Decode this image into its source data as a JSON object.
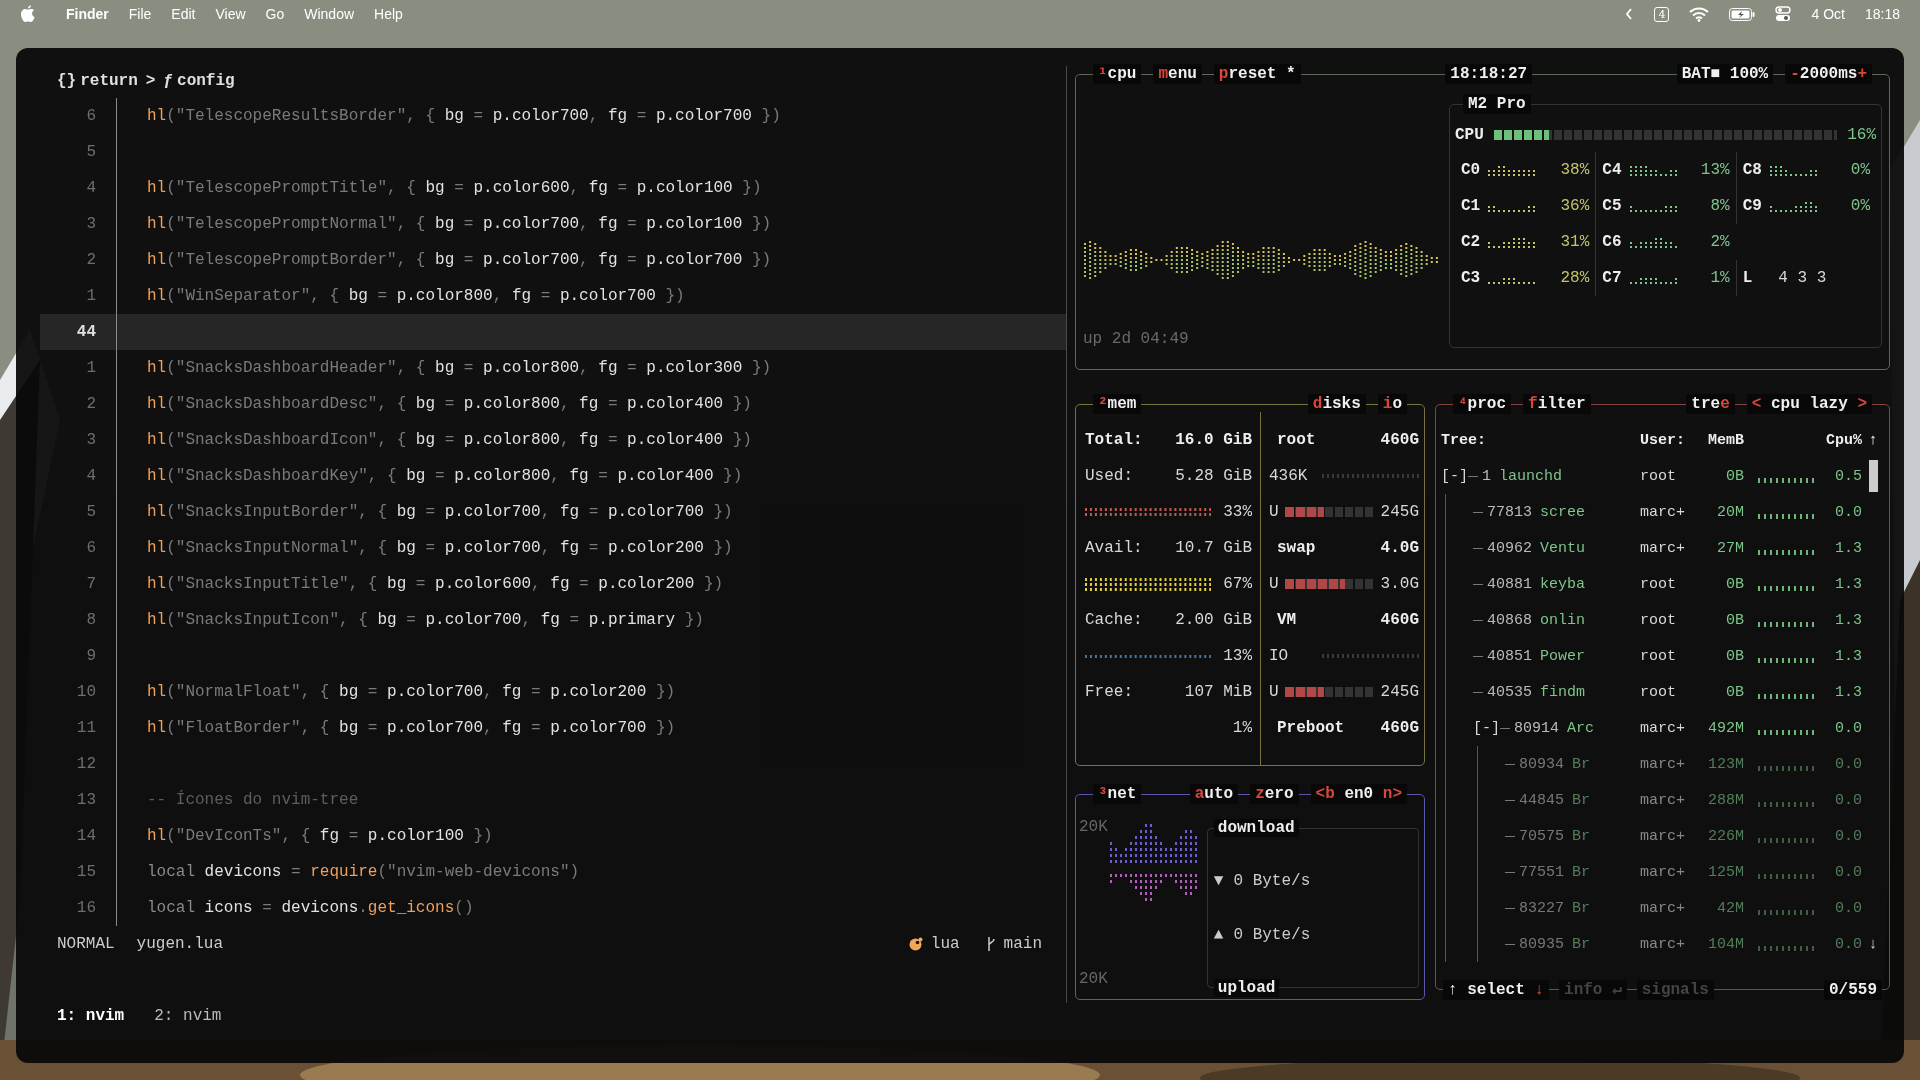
{
  "menubar": {
    "app": "Finder",
    "menus": [
      "File",
      "Edit",
      "View",
      "Go",
      "Window",
      "Help"
    ],
    "calendar_day": "4",
    "date": "4 Oct",
    "time": "18:18"
  },
  "editor": {
    "breadcrumb": [
      {
        "icon": "{}",
        "text": "return"
      },
      {
        "icon": "ƒ",
        "text": "config"
      }
    ],
    "separator": ">",
    "lines": [
      {
        "num": "6",
        "current": false,
        "tokens": [
          {
            "kind": "fn",
            "text": "hl"
          },
          {
            "kind": "dim",
            "text": "(\"TelescopeResultsBorder\", { "
          },
          {
            "kind": "text",
            "text": "bg"
          },
          {
            "kind": "dim",
            "text": " = "
          },
          {
            "kind": "text",
            "text": "p.color700"
          },
          {
            "kind": "dim",
            "text": ", "
          },
          {
            "kind": "text",
            "text": "fg"
          },
          {
            "kind": "dim",
            "text": " = "
          },
          {
            "kind": "text",
            "text": "p.color700"
          },
          {
            "kind": "dim",
            "text": " })"
          }
        ]
      },
      {
        "num": "5",
        "current": false
      },
      {
        "num": "4",
        "current": false,
        "tokens": [
          {
            "kind": "fn",
            "text": "hl"
          },
          {
            "kind": "dim",
            "text": "(\"TelescopePromptTitle\", { "
          },
          {
            "kind": "text",
            "text": "bg"
          },
          {
            "kind": "dim",
            "text": " = "
          },
          {
            "kind": "text",
            "text": "p.color600"
          },
          {
            "kind": "dim",
            "text": ", "
          },
          {
            "kind": "text",
            "text": "fg"
          },
          {
            "kind": "dim",
            "text": " = "
          },
          {
            "kind": "text",
            "text": "p.color100"
          },
          {
            "kind": "dim",
            "text": " })"
          }
        ]
      },
      {
        "num": "3",
        "current": false,
        "tokens": [
          {
            "kind": "fn",
            "text": "hl"
          },
          {
            "kind": "dim",
            "text": "(\"TelescopePromptNormal\", { "
          },
          {
            "kind": "text",
            "text": "bg"
          },
          {
            "kind": "dim",
            "text": " = "
          },
          {
            "kind": "text",
            "text": "p.color700"
          },
          {
            "kind": "dim",
            "text": ", "
          },
          {
            "kind": "text",
            "text": "fg"
          },
          {
            "kind": "dim",
            "text": " = "
          },
          {
            "kind": "text",
            "text": "p.color100"
          },
          {
            "kind": "dim",
            "text": " })"
          }
        ]
      },
      {
        "num": "2",
        "current": false,
        "tokens": [
          {
            "kind": "fn",
            "text": "hl"
          },
          {
            "kind": "dim",
            "text": "(\"TelescopePromptBorder\", { "
          },
          {
            "kind": "text",
            "text": "bg"
          },
          {
            "kind": "dim",
            "text": " = "
          },
          {
            "kind": "text",
            "text": "p.color700"
          },
          {
            "kind": "dim",
            "text": ", "
          },
          {
            "kind": "text",
            "text": "fg"
          },
          {
            "kind": "dim",
            "text": " = "
          },
          {
            "kind": "text",
            "text": "p.color700"
          },
          {
            "kind": "dim",
            "text": " })"
          }
        ]
      },
      {
        "num": "1",
        "current": false,
        "tokens": [
          {
            "kind": "fn",
            "text": "hl"
          },
          {
            "kind": "dim",
            "text": "(\"WinSeparator\", { "
          },
          {
            "kind": "text",
            "text": "bg"
          },
          {
            "kind": "dim",
            "text": " = "
          },
          {
            "kind": "text",
            "text": "p.color800"
          },
          {
            "kind": "dim",
            "text": ", "
          },
          {
            "kind": "text",
            "text": "fg"
          },
          {
            "kind": "dim",
            "text": " = "
          },
          {
            "kind": "text",
            "text": "p.color700"
          },
          {
            "kind": "dim",
            "text": " })"
          }
        ]
      },
      {
        "num": "44",
        "current": true
      },
      {
        "num": "1",
        "current": false,
        "tokens": [
          {
            "kind": "fn",
            "text": "hl"
          },
          {
            "kind": "dim",
            "text": "(\"SnacksDashboardHeader\", { "
          },
          {
            "kind": "text",
            "text": "bg"
          },
          {
            "kind": "dim",
            "text": " = "
          },
          {
            "kind": "text",
            "text": "p.color800"
          },
          {
            "kind": "dim",
            "text": ", "
          },
          {
            "kind": "text",
            "text": "fg"
          },
          {
            "kind": "dim",
            "text": " = "
          },
          {
            "kind": "text",
            "text": "p.color300"
          },
          {
            "kind": "dim",
            "text": " })"
          }
        ]
      },
      {
        "num": "2",
        "current": false,
        "tokens": [
          {
            "kind": "fn",
            "text": "hl"
          },
          {
            "kind": "dim",
            "text": "(\"SnacksDashboardDesc\", { "
          },
          {
            "kind": "text",
            "text": "bg"
          },
          {
            "kind": "dim",
            "text": " = "
          },
          {
            "kind": "text",
            "text": "p.color800"
          },
          {
            "kind": "dim",
            "text": ", "
          },
          {
            "kind": "text",
            "text": "fg"
          },
          {
            "kind": "dim",
            "text": " = "
          },
          {
            "kind": "text",
            "text": "p.color400"
          },
          {
            "kind": "dim",
            "text": " })"
          }
        ]
      },
      {
        "num": "3",
        "current": false,
        "tokens": [
          {
            "kind": "fn",
            "text": "hl"
          },
          {
            "kind": "dim",
            "text": "(\"SnacksDashboardIcon\", { "
          },
          {
            "kind": "text",
            "text": "bg"
          },
          {
            "kind": "dim",
            "text": " = "
          },
          {
            "kind": "text",
            "text": "p.color800"
          },
          {
            "kind": "dim",
            "text": ", "
          },
          {
            "kind": "text",
            "text": "fg"
          },
          {
            "kind": "dim",
            "text": " = "
          },
          {
            "kind": "text",
            "text": "p.color400"
          },
          {
            "kind": "dim",
            "text": " })"
          }
        ]
      },
      {
        "num": "4",
        "current": false,
        "tokens": [
          {
            "kind": "fn",
            "text": "hl"
          },
          {
            "kind": "dim",
            "text": "(\"SnacksDashboardKey\", { "
          },
          {
            "kind": "text",
            "text": "bg"
          },
          {
            "kind": "dim",
            "text": " = "
          },
          {
            "kind": "text",
            "text": "p.color800"
          },
          {
            "kind": "dim",
            "text": ", "
          },
          {
            "kind": "text",
            "text": "fg"
          },
          {
            "kind": "dim",
            "text": " = "
          },
          {
            "kind": "text",
            "text": "p.color400"
          },
          {
            "kind": "dim",
            "text": " })"
          }
        ]
      },
      {
        "num": "5",
        "current": false,
        "tokens": [
          {
            "kind": "fn",
            "text": "hl"
          },
          {
            "kind": "dim",
            "text": "(\"SnacksInputBorder\", { "
          },
          {
            "kind": "text",
            "text": "bg"
          },
          {
            "kind": "dim",
            "text": " = "
          },
          {
            "kind": "text",
            "text": "p.color700"
          },
          {
            "kind": "dim",
            "text": ", "
          },
          {
            "kind": "text",
            "text": "fg"
          },
          {
            "kind": "dim",
            "text": " = "
          },
          {
            "kind": "text",
            "text": "p.color700"
          },
          {
            "kind": "dim",
            "text": " })"
          }
        ]
      },
      {
        "num": "6",
        "current": false,
        "tokens": [
          {
            "kind": "fn",
            "text": "hl"
          },
          {
            "kind": "dim",
            "text": "(\"SnacksInputNormal\", { "
          },
          {
            "kind": "text",
            "text": "bg"
          },
          {
            "kind": "dim",
            "text": " = "
          },
          {
            "kind": "text",
            "text": "p.color700"
          },
          {
            "kind": "dim",
            "text": ", "
          },
          {
            "kind": "text",
            "text": "fg"
          },
          {
            "kind": "dim",
            "text": " = "
          },
          {
            "kind": "text",
            "text": "p.color200"
          },
          {
            "kind": "dim",
            "text": " })"
          }
        ]
      },
      {
        "num": "7",
        "current": false,
        "tokens": [
          {
            "kind": "fn",
            "text": "hl"
          },
          {
            "kind": "dim",
            "text": "(\"SnacksInputTitle\", { "
          },
          {
            "kind": "text",
            "text": "bg"
          },
          {
            "kind": "dim",
            "text": " = "
          },
          {
            "kind": "text",
            "text": "p.color600"
          },
          {
            "kind": "dim",
            "text": ", "
          },
          {
            "kind": "text",
            "text": "fg"
          },
          {
            "kind": "dim",
            "text": " = "
          },
          {
            "kind": "text",
            "text": "p.color200"
          },
          {
            "kind": "dim",
            "text": " })"
          }
        ]
      },
      {
        "num": "8",
        "current": false,
        "tokens": [
          {
            "kind": "fn",
            "text": "hl"
          },
          {
            "kind": "dim",
            "text": "(\"SnacksInputIcon\", { "
          },
          {
            "kind": "text",
            "text": "bg"
          },
          {
            "kind": "dim",
            "text": " = "
          },
          {
            "kind": "text",
            "text": "p.color700"
          },
          {
            "kind": "dim",
            "text": ", "
          },
          {
            "kind": "text",
            "text": "fg"
          },
          {
            "kind": "dim",
            "text": " = "
          },
          {
            "kind": "text",
            "text": "p.primary"
          },
          {
            "kind": "dim",
            "text": " })"
          }
        ]
      },
      {
        "num": "9",
        "current": false
      },
      {
        "num": "10",
        "current": false,
        "tokens": [
          {
            "kind": "fn",
            "text": "hl"
          },
          {
            "kind": "dim",
            "text": "(\"NormalFloat\", { "
          },
          {
            "kind": "text",
            "text": "bg"
          },
          {
            "kind": "dim",
            "text": " = "
          },
          {
            "kind": "text",
            "text": "p.color700"
          },
          {
            "kind": "dim",
            "text": ", "
          },
          {
            "kind": "text",
            "text": "fg"
          },
          {
            "kind": "dim",
            "text": " = "
          },
          {
            "kind": "text",
            "text": "p.color200"
          },
          {
            "kind": "dim",
            "text": " })"
          }
        ]
      },
      {
        "num": "11",
        "current": false,
        "tokens": [
          {
            "kind": "fn",
            "text": "hl"
          },
          {
            "kind": "dim",
            "text": "(\"FloatBorder\", { "
          },
          {
            "kind": "text",
            "text": "bg"
          },
          {
            "kind": "dim",
            "text": " = "
          },
          {
            "kind": "text",
            "text": "p.color700"
          },
          {
            "kind": "dim",
            "text": ", "
          },
          {
            "kind": "text",
            "text": "fg"
          },
          {
            "kind": "dim",
            "text": " = "
          },
          {
            "kind": "text",
            "text": "p.color700"
          },
          {
            "kind": "dim",
            "text": " })"
          }
        ]
      },
      {
        "num": "12",
        "current": false
      },
      {
        "num": "13",
        "current": false,
        "tokens": [
          {
            "kind": "comment",
            "text": "-- Ícones do nvim-tree"
          }
        ]
      },
      {
        "num": "14",
        "current": false,
        "tokens": [
          {
            "kind": "fn",
            "text": "hl"
          },
          {
            "kind": "dim",
            "text": "(\"DevIconTs\", { "
          },
          {
            "kind": "text",
            "text": "fg"
          },
          {
            "kind": "dim",
            "text": " = "
          },
          {
            "kind": "text",
            "text": "p.color100"
          },
          {
            "kind": "dim",
            "text": " })"
          }
        ]
      },
      {
        "num": "15",
        "current": false,
        "tokens": [
          {
            "kind": "kw",
            "text": "local "
          },
          {
            "kind": "text",
            "text": "devicons"
          },
          {
            "kind": "dim",
            "text": " = "
          },
          {
            "kind": "fn",
            "text": "require"
          },
          {
            "kind": "dim",
            "text": "(\"nvim-web-devicons\")"
          }
        ]
      },
      {
        "num": "16",
        "current": false,
        "tokens": [
          {
            "kind": "kw",
            "text": "local "
          },
          {
            "kind": "text",
            "text": "icons"
          },
          {
            "kind": "dim",
            "text": " = "
          },
          {
            "kind": "text",
            "text": "devicons"
          },
          {
            "kind": "dim",
            "text": "."
          },
          {
            "kind": "fn",
            "text": "get_icons"
          },
          {
            "kind": "dim",
            "text": "()"
          }
        ]
      }
    ],
    "status": {
      "mode": "NORMAL",
      "file": "yugen.lua",
      "filetype": "lua",
      "branch": "main"
    },
    "tabs": [
      {
        "label": "1: nvim",
        "selected": true
      },
      {
        "label": "2: nvim",
        "selected": false
      }
    ]
  },
  "cpu": {
    "header": [
      {
        "parts": [
          {
            "text": "¹",
            "hot": true
          },
          {
            "text": "cpu",
            "hot": false
          }
        ]
      },
      {
        "parts": [
          {
            "text": "m",
            "hot": true
          },
          {
            "text": "enu",
            "hot": false
          }
        ]
      },
      {
        "parts": [
          {
            "text": "p",
            "hot": true
          },
          {
            "text": "reset *",
            "hot": false
          }
        ]
      }
    ],
    "clock": "18:18:27",
    "battery": "BAT■ 100%",
    "interval": {
      "minus": "-",
      "value": "2000ms",
      "plus": "+"
    },
    "uptime": "up 2d 04:49",
    "model": "M2 Pro",
    "total": {
      "label": "CPU",
      "level": 0.16,
      "reading": "16%"
    },
    "cores": [
      {
        "name": "C0",
        "reading": "38%",
        "color": "#c5c36e"
      },
      {
        "name": "C1",
        "reading": "36%",
        "color": "#c5c36e"
      },
      {
        "name": "C2",
        "reading": "31%",
        "color": "#c5c36e"
      },
      {
        "name": "C3",
        "reading": "28%",
        "color": "#c5c36e"
      },
      {
        "name": "C4",
        "reading": "13%",
        "color": "#7ec58c"
      },
      {
        "name": "C5",
        "reading": "8%",
        "color": "#7ec58c"
      },
      {
        "name": "C6",
        "reading": "2%",
        "color": "#7ec58c"
      },
      {
        "name": "C7",
        "reading": "1%",
        "color": "#7ec58c"
      },
      {
        "name": "C8",
        "reading": "0%",
        "color": "#7ec58c"
      },
      {
        "name": "C9",
        "reading": "0%",
        "color": "#7ec58c"
      }
    ],
    "load": {
      "label": "L",
      "values": "4 3 3"
    }
  },
  "mem": {
    "header": [
      {
        "parts": [
          {
            "text": "²",
            "hot": true
          },
          {
            "text": "mem",
            "hot": false
          }
        ]
      },
      {
        "parts": [
          {
            "text": "d",
            "hot": true
          },
          {
            "text": "isks",
            "hot": false
          }
        ]
      },
      {
        "parts": [
          {
            "text": "i",
            "hot": true
          },
          {
            "text": "o",
            "hot": false
          }
        ]
      }
    ],
    "items": [
      {
        "label": "Total:",
        "value": "16.0 GiB",
        "bold": true
      },
      {
        "label": "Used:",
        "value": "5.28 GiB",
        "bold": false,
        "reading": "33%",
        "color": "#c65a52"
      },
      {
        "label": "Avail:",
        "value": "10.7 GiB",
        "bold": false,
        "reading": "67%",
        "color": "#e6d43c"
      },
      {
        "label": "Cache:",
        "value": "2.00 GiB",
        "bold": false,
        "reading": "13%",
        "color": "#3f78a8"
      },
      {
        "label": "Free:",
        "value": "107 MiB",
        "bold": false,
        "reading": "1%"
      }
    ],
    "disks": [
      {
        "name": "root",
        "size": "460G",
        "io": "436K",
        "usage": {
          "label": "U",
          "level": 0.44,
          "reading": "245G"
        }
      },
      {
        "name": "swap",
        "size": "4.0G",
        "usage": {
          "label": "U",
          "level": 0.67,
          "reading": "3.0G"
        }
      },
      {
        "name": "VM",
        "size": "460G",
        "io": "IO",
        "usage": {
          "label": "U",
          "level": 0.44,
          "reading": "245G"
        }
      },
      {
        "name": "Preboot",
        "size": "460G"
      }
    ]
  },
  "net": {
    "header": [
      {
        "parts": [
          {
            "text": "³",
            "hot": true
          },
          {
            "text": "net",
            "hot": false
          }
        ]
      },
      {
        "parts": [
          {
            "text": "a",
            "hot": true
          },
          {
            "text": "uto",
            "hot": false
          }
        ]
      },
      {
        "parts": [
          {
            "text": "z",
            "hot": true
          },
          {
            "text": "ero",
            "hot": false
          }
        ]
      },
      {
        "parts": [
          {
            "text": "<b",
            "hot": true
          },
          {
            "text": " en0 ",
            "hot": false
          },
          {
            "text": "n>",
            "hot": true
          }
        ]
      }
    ],
    "scale_top": "20K",
    "scale_bottom": "20K",
    "download_label": "download",
    "down": {
      "arrow": "▼",
      "rate": "0 Byte/s"
    },
    "up": {
      "arrow": "▲",
      "rate": "0 Byte/s"
    },
    "upload_label": "upload"
  },
  "proc": {
    "header": [
      {
        "parts": [
          {
            "text": "⁴",
            "hot": true
          },
          {
            "text": "proc",
            "hot": false
          }
        ]
      },
      {
        "parts": [
          {
            "text": "f",
            "hot": true
          },
          {
            "text": "ilter",
            "hot": false
          }
        ]
      },
      {
        "parts": [
          {
            "text": "tre",
            "hot": false
          },
          {
            "text": "e",
            "hot": true
          }
        ]
      },
      {
        "parts": [
          {
            "text": "<",
            "hot": true
          },
          {
            "text": " cpu lazy ",
            "hot": false
          },
          {
            "text": ">",
            "hot": true
          }
        ]
      }
    ],
    "columns": {
      "tree": "Tree:",
      "user": "User:",
      "mem": "MemB",
      "cpu": "Cpu%",
      "sort": "↑"
    },
    "rows": [
      {
        "toggle": "[-]",
        "pid": "1",
        "name": "launchd",
        "user": "root",
        "mem": "0B",
        "cpu": "0.5",
        "children": [
          {
            "pid": "77813",
            "name": "scree",
            "user": "marc+",
            "mem": "20M",
            "cpu": "0.0"
          },
          {
            "pid": "40962",
            "name": "Ventu",
            "user": "marc+",
            "mem": "27M",
            "cpu": "1.3"
          },
          {
            "pid": "40881",
            "name": "keyba",
            "user": "root",
            "mem": "0B",
            "cpu": "1.3"
          },
          {
            "pid": "40868",
            "name": "onlin",
            "user": "root",
            "mem": "0B",
            "cpu": "1.3"
          },
          {
            "pid": "40851",
            "name": "Power",
            "user": "root",
            "mem": "0B",
            "cpu": "1.3"
          },
          {
            "pid": "40535",
            "name": "findm",
            "user": "root",
            "mem": "0B",
            "cpu": "1.3"
          },
          {
            "toggle": "[-]",
            "pid": "80914",
            "name": "Arc",
            "user": "marc+",
            "mem": "492M",
            "cpu": "0.0",
            "children": [
              {
                "pid": "80934",
                "name": "Br",
                "user": "marc+",
                "mem": "123M",
                "cpu": "0.0"
              },
              {
                "pid": "44845",
                "name": "Br",
                "user": "marc+",
                "mem": "288M",
                "cpu": "0.0"
              },
              {
                "pid": "70575",
                "name": "Br",
                "user": "marc+",
                "mem": "226M",
                "cpu": "0.0"
              },
              {
                "pid": "77551",
                "name": "Br",
                "user": "marc+",
                "mem": "125M",
                "cpu": "0.0"
              },
              {
                "pid": "83227",
                "name": "Br",
                "user": "marc+",
                "mem": "42M",
                "cpu": "0.0"
              },
              {
                "pid": "80935",
                "name": "Br",
                "user": "marc+",
                "mem": "104M",
                "cpu": "0.0"
              }
            ]
          }
        ]
      }
    ],
    "more_below": "↓",
    "footer": [
      {
        "parts": [
          {
            "text": "↑",
            "hot": false
          },
          {
            "text": " select ",
            "hot": false
          },
          {
            "text": "↓",
            "hot": true
          }
        ],
        "enabled": true
      },
      {
        "parts": [
          {
            "text": "info ",
            "hot": false
          },
          {
            "text": "↵",
            "hot": false
          }
        ],
        "enabled": false
      },
      {
        "parts": [
          {
            "text": "signals",
            "hot": false
          }
        ],
        "enabled": false
      }
    ],
    "count": "0/559"
  }
}
